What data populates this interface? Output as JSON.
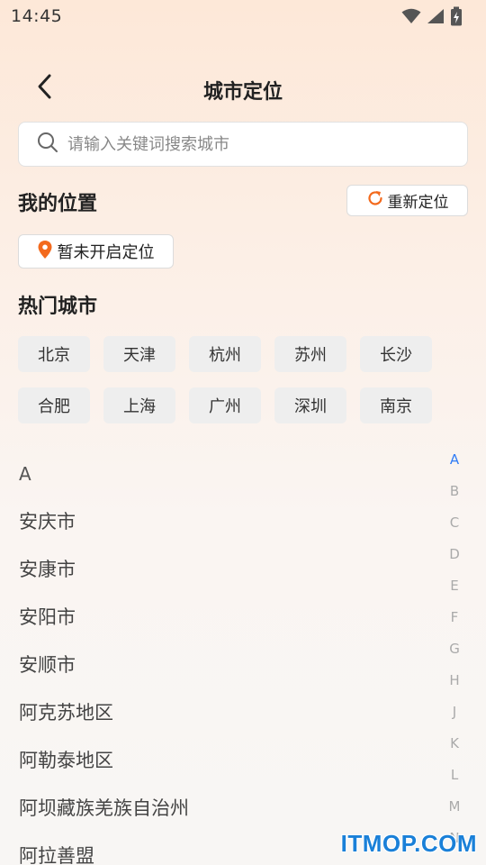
{
  "status_bar": {
    "time": "14:45",
    "icons": [
      "wifi-icon",
      "signal-icon",
      "battery-charging-icon"
    ]
  },
  "header": {
    "title": "城市定位",
    "back_icon": "chevron-left-icon"
  },
  "search": {
    "placeholder": "请输入关键词搜索城市",
    "value": "",
    "icon": "search-icon"
  },
  "my_location": {
    "title": "我的位置",
    "relocate_label": "重新定位",
    "relocate_icon": "refresh-icon",
    "status_label": "暂未开启定位",
    "status_icon": "location-pin-icon"
  },
  "hot_cities": {
    "title": "热门城市",
    "items": [
      "北京",
      "天津",
      "杭州",
      "苏州",
      "长沙",
      "合肥",
      "上海",
      "广州",
      "深圳",
      "南京"
    ]
  },
  "city_list": {
    "letter": "A",
    "items": [
      "安庆市",
      "安康市",
      "安阳市",
      "安顺市",
      "阿克苏地区",
      "阿勒泰地区",
      "阿坝藏族羌族自治州",
      "阿拉善盟"
    ]
  },
  "alpha_index": {
    "active": "A",
    "letters": [
      "A",
      "B",
      "C",
      "D",
      "E",
      "F",
      "G",
      "H",
      "J",
      "K",
      "L",
      "M",
      "N"
    ]
  },
  "watermark": "ITMOP.COM",
  "colors": {
    "accent_orange": "#f36a1d",
    "index_active": "#2f7cf6",
    "watermark": "#1a80d8"
  }
}
